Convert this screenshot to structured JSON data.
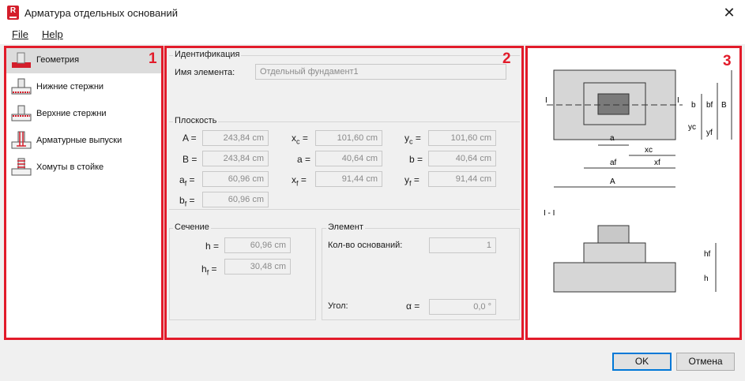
{
  "window": {
    "title": "Арматура отдельных оснований",
    "close_symbol": "✕",
    "app_icon_letter": "R"
  },
  "menu": {
    "file": "File",
    "help": "Help"
  },
  "annotations": {
    "n1": "1",
    "n2": "2",
    "n3": "3",
    "color": "#e21b2a"
  },
  "nav": {
    "items": [
      {
        "label": "Геометрия",
        "icon": "footing-geometry-icon",
        "active": true
      },
      {
        "label": "Нижние стержни",
        "icon": "bottom-bars-icon"
      },
      {
        "label": "Верхние стержни",
        "icon": "top-bars-icon"
      },
      {
        "label": "Арматурные выпуски",
        "icon": "starter-bars-icon"
      },
      {
        "label": "Хомуты в стойке",
        "icon": "column-stirrups-icon"
      }
    ]
  },
  "identification": {
    "title": "Идентификация",
    "name_label": "Имя элемента:",
    "name_value": "Отдельный фундамент1"
  },
  "plane": {
    "title": "Плоскость",
    "A": "243,84 cm",
    "B": "243,84 cm",
    "af": "60,96 cm",
    "bf": "60,96 cm",
    "xc": "101,60 cm",
    "a": "40,64 cm",
    "xf": "91,44 cm",
    "yc": "101,60 cm",
    "b": "40,64 cm",
    "yf": "91,44 cm"
  },
  "section": {
    "title": "Сечение",
    "h": "60,96 cm",
    "hf": "30,48 cm"
  },
  "element": {
    "title": "Элемент",
    "count_label": "Кол-во оснований:",
    "count_value": "1",
    "angle_label": "Угол:",
    "angle_value": "0,0 °"
  },
  "diagram": {
    "section_label": "I - I",
    "cut_label": "I",
    "dims": {
      "a": "a",
      "xc": "xc",
      "af": "af",
      "xf": "xf",
      "A": "A",
      "b": "b",
      "bf": "bf",
      "B": "B",
      "yc": "yc",
      "yf": "yf",
      "h": "h",
      "hf": "hf"
    }
  },
  "buttons": {
    "ok": "OK",
    "cancel": "Отмена"
  },
  "colors": {
    "accent": "#0078d7",
    "footing_fill": "#d6d6d6",
    "column_fill": "#7a7a7a"
  }
}
